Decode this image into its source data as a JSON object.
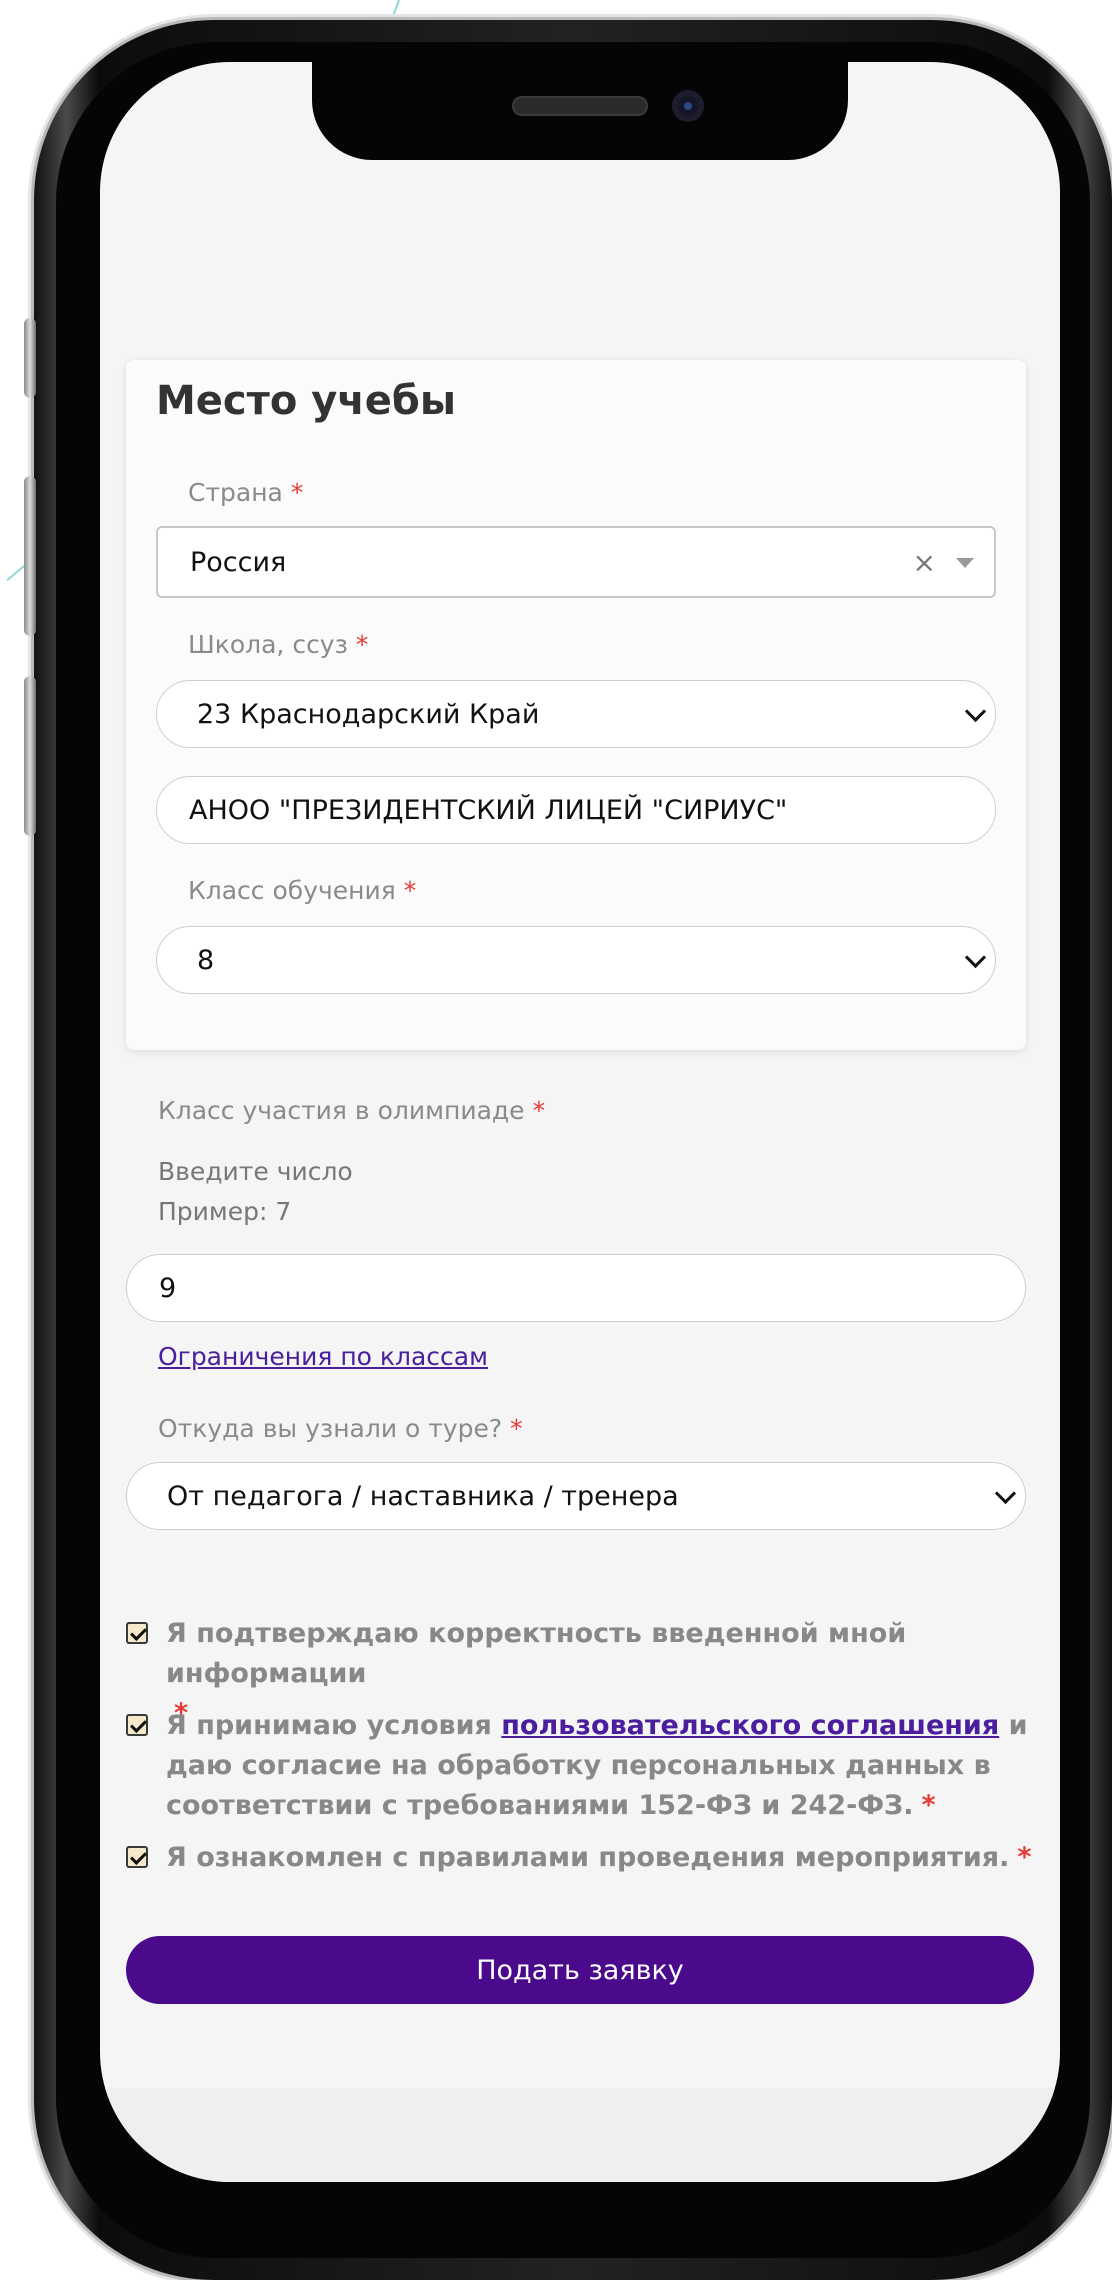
{
  "study": {
    "title": "Место учебы",
    "country": {
      "label": "Страна",
      "required": "*",
      "value": "Россия",
      "clear": "×"
    },
    "school": {
      "label": "Школа, ссуз",
      "required": "*",
      "region_value": "23 Краснодарский Край",
      "school_value": "АНОО \"ПРЕЗИДЕНТСКИЙ ЛИЦЕЙ \"СИРИУС\""
    },
    "grade": {
      "label": "Класс обучения",
      "required": "*",
      "value": "8"
    }
  },
  "olympiad": {
    "label": "Класс участия в олимпиаде",
    "required": "*",
    "hint1": "Введите число",
    "hint2": "Пример: 7",
    "value": "9",
    "limits_link": "Ограничения по классам"
  },
  "source": {
    "label": "Откуда вы узнали о туре?",
    "required": "*",
    "value": "От педагога / наставника / тренера"
  },
  "agreements": {
    "item1": {
      "text": "Я подтверждаю корректность введенной мной информации",
      "required": "*"
    },
    "item2": {
      "prefix": "Я принимаю условия ",
      "link": "пользовательского соглашения",
      "suffix": " и даю согласие на обработку персональных данных в соответствии с требованиями 152-ФЗ и 242-ФЗ.",
      "required": "*"
    },
    "item3": {
      "text": "Я ознакомлен с правилами проведения мероприятия.",
      "required": "*"
    }
  },
  "submit_label": "Подать заявку"
}
